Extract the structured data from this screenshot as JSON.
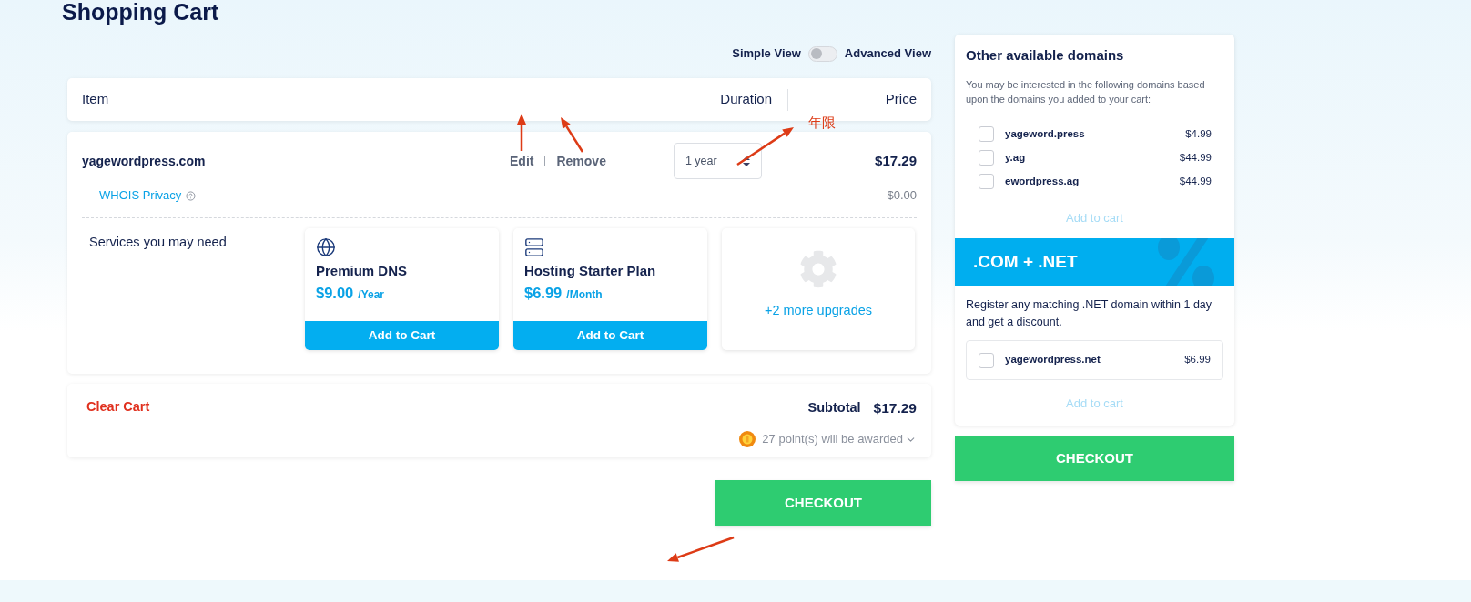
{
  "page": {
    "title": "Shopping Cart"
  },
  "view_toggle": {
    "left_label": "Simple View",
    "right_label": "Advanced View",
    "on": false
  },
  "table": {
    "columns": [
      "Item",
      "Duration",
      "Price"
    ]
  },
  "cart_item": {
    "domain": "yagewordpress.com",
    "actions": [
      "Edit",
      "Remove"
    ],
    "duration": "1 year",
    "price": "$17.29",
    "addon": {
      "label": "WHOIS Privacy",
      "price": "$0.00"
    }
  },
  "services": {
    "heading": "Services you may need",
    "cards": [
      {
        "kind": "dns",
        "name": "Premium DNS",
        "price": "$9.00",
        "period": "/Year",
        "button": "Add to Cart"
      },
      {
        "kind": "hosting",
        "name": "Hosting Starter Plan",
        "price": "$6.99",
        "period": "/Month",
        "button": "Add to Cart"
      }
    ],
    "more": "+2 more upgrades"
  },
  "summary": {
    "clear": "Clear Cart",
    "subtotal_label": "Subtotal",
    "subtotal": "$17.29",
    "points": "27 point(s) will be awarded"
  },
  "checkout": "CHECKOUT",
  "sidebar": {
    "title": "Other available domains",
    "description": "You may be interested in the following domains based upon the domains you added to your cart:",
    "domains": [
      {
        "name": "yageword.press",
        "price": "$4.99",
        "checked": false
      },
      {
        "name": "y.ag",
        "price": "$44.99",
        "checked": false
      },
      {
        "name": "ewordpress.ag",
        "price": "$44.99",
        "checked": false
      }
    ],
    "add_button": "Add to cart",
    "promo": {
      "title": ".COM + .NET",
      "text": "Register any matching .NET domain within 1 day and get a discount.",
      "domains": [
        {
          "name": "yagewordpress.net",
          "price": "$6.99",
          "checked": false
        }
      ],
      "add_button": "Add to cart"
    },
    "checkout": "CHECKOUT"
  },
  "annotation": {
    "label": "年限"
  }
}
